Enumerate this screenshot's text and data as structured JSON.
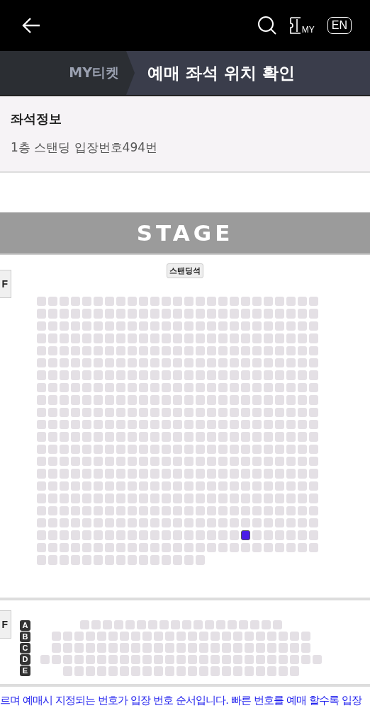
{
  "top_bar": {
    "language": "EN",
    "my_label": "MY"
  },
  "breadcrumb": {
    "parent": "MY티켓",
    "current": "예매 좌석 위치 확인"
  },
  "seat_info": {
    "title": "좌석정보",
    "value": "1층 스탠딩 입장번호494번"
  },
  "seat_map": {
    "stage": "STAGE",
    "floor_tabs": [
      "F",
      "F"
    ],
    "standing": {
      "label": "스탠딩석",
      "rows": [
        [
          false,
          false,
          false,
          false,
          false,
          false,
          false,
          false,
          false,
          false,
          false,
          false,
          false,
          false,
          false,
          false,
          false,
          false,
          false,
          false,
          false,
          false,
          false,
          false,
          false
        ],
        [
          false,
          false,
          false,
          false,
          false,
          false,
          false,
          false,
          false,
          false,
          false,
          false,
          false,
          false,
          false,
          false,
          false,
          false,
          false,
          false,
          false,
          false,
          false,
          false,
          false
        ],
        [
          false,
          false,
          false,
          false,
          false,
          false,
          false,
          false,
          false,
          false,
          false,
          false,
          false,
          false,
          false,
          false,
          false,
          false,
          false,
          false,
          false,
          false,
          false,
          false,
          false
        ],
        [
          false,
          false,
          false,
          false,
          false,
          false,
          false,
          false,
          false,
          false,
          false,
          false,
          false,
          false,
          false,
          false,
          false,
          false,
          false,
          false,
          false,
          false,
          false,
          false,
          false
        ],
        [
          false,
          false,
          false,
          false,
          false,
          false,
          false,
          false,
          false,
          false,
          false,
          false,
          false,
          false,
          false,
          false,
          false,
          false,
          false,
          false,
          false,
          false,
          false,
          false,
          false
        ],
        [
          false,
          false,
          false,
          false,
          false,
          false,
          false,
          false,
          false,
          false,
          false,
          false,
          false,
          false,
          false,
          false,
          false,
          false,
          false,
          false,
          false,
          false,
          false,
          false,
          false
        ],
        [
          false,
          false,
          false,
          false,
          false,
          false,
          false,
          false,
          false,
          false,
          false,
          false,
          false,
          false,
          false,
          false,
          false,
          false,
          false,
          false,
          false,
          false,
          false,
          false,
          false
        ],
        [
          false,
          false,
          false,
          false,
          false,
          false,
          false,
          false,
          false,
          false,
          false,
          false,
          false,
          false,
          false,
          false,
          false,
          false,
          false,
          false,
          false,
          false,
          false,
          false,
          false
        ],
        [
          false,
          false,
          false,
          false,
          false,
          false,
          false,
          false,
          false,
          false,
          false,
          false,
          false,
          false,
          false,
          false,
          false,
          false,
          false,
          false,
          false,
          false,
          false,
          false,
          false
        ],
        [
          false,
          false,
          false,
          false,
          false,
          false,
          false,
          false,
          false,
          false,
          false,
          false,
          false,
          false,
          false,
          false,
          false,
          false,
          false,
          false,
          false,
          false,
          false,
          false,
          false
        ],
        [
          false,
          false,
          false,
          false,
          false,
          false,
          false,
          false,
          false,
          false,
          false,
          false,
          false,
          false,
          false,
          false,
          false,
          false,
          false,
          false,
          false,
          false,
          false,
          false,
          false
        ],
        [
          false,
          false,
          false,
          false,
          false,
          false,
          false,
          false,
          false,
          false,
          false,
          false,
          false,
          false,
          false,
          false,
          false,
          false,
          false,
          false,
          false,
          false,
          false,
          false,
          false
        ],
        [
          false,
          false,
          false,
          false,
          false,
          false,
          false,
          false,
          false,
          false,
          false,
          false,
          false,
          false,
          false,
          false,
          false,
          false,
          false,
          false,
          false,
          false,
          false,
          false,
          false
        ],
        [
          false,
          false,
          false,
          false,
          false,
          false,
          false,
          false,
          false,
          false,
          false,
          false,
          false,
          false,
          false,
          false,
          false,
          false,
          false,
          false,
          false,
          false,
          false,
          false,
          false
        ],
        [
          false,
          false,
          false,
          false,
          false,
          false,
          false,
          false,
          false,
          false,
          false,
          false,
          false,
          false,
          false,
          false,
          false,
          false,
          false,
          false,
          false,
          false,
          false,
          false,
          false
        ],
        [
          false,
          false,
          false,
          false,
          false,
          false,
          false,
          false,
          false,
          false,
          false,
          false,
          false,
          false,
          false,
          false,
          false,
          false,
          false,
          false,
          false,
          false,
          false,
          false,
          false
        ],
        [
          false,
          false,
          false,
          false,
          false,
          false,
          false,
          false,
          false,
          false,
          false,
          false,
          false,
          false,
          false,
          false,
          false,
          false,
          false,
          false,
          false,
          false,
          false,
          false,
          false
        ],
        [
          false,
          false,
          false,
          false,
          false,
          false,
          false,
          false,
          false,
          false,
          false,
          false,
          false,
          false,
          false,
          false,
          false,
          false,
          false,
          false,
          false,
          false,
          false,
          false,
          false
        ],
        [
          false,
          false,
          false,
          false,
          false,
          false,
          false,
          false,
          false,
          false,
          false,
          false,
          false,
          false,
          false,
          false,
          false,
          false,
          false,
          false,
          false,
          false,
          false,
          false,
          false
        ],
        [
          false,
          false,
          false,
          false,
          false,
          false,
          false,
          false,
          false,
          false,
          false,
          false,
          false,
          false,
          false,
          false,
          false,
          false,
          true,
          false,
          false,
          false,
          false,
          false,
          false
        ],
        [
          false,
          false,
          false,
          false,
          false,
          false,
          false,
          false,
          false,
          false,
          false,
          false,
          false,
          false,
          false,
          false,
          false,
          false,
          false,
          false,
          false,
          false,
          false,
          false,
          false
        ],
        [
          false,
          false,
          false,
          false,
          false,
          false,
          false,
          false,
          false,
          false,
          false,
          false,
          false,
          false,
          false
        ]
      ]
    },
    "balcony": {
      "rows": [
        {
          "label": "A",
          "seats": [
            false,
            false,
            false,
            false,
            false,
            false,
            false,
            false,
            false,
            false,
            false,
            false,
            false,
            false,
            false,
            false,
            false,
            false
          ]
        },
        {
          "label": "B",
          "seats": [
            false,
            false,
            false,
            false,
            false,
            false,
            false,
            false,
            false,
            false,
            false,
            false,
            false,
            false,
            false,
            false,
            false,
            false,
            false,
            false,
            false,
            false,
            false
          ]
        },
        {
          "label": "C",
          "seats": [
            false,
            false,
            false,
            false,
            false,
            false,
            false,
            false,
            false,
            false,
            false,
            false,
            false,
            false,
            false,
            false,
            false,
            false,
            false,
            false,
            false,
            false,
            false
          ]
        },
        {
          "label": "D",
          "seats": [
            false,
            false,
            false,
            false,
            false,
            false,
            false,
            false,
            false,
            false,
            false,
            false,
            false,
            false,
            false,
            false,
            false,
            false,
            false,
            false,
            false,
            false,
            false,
            false,
            false
          ]
        },
        {
          "label": "E",
          "seats": [
            false,
            false,
            false,
            false,
            false,
            false,
            false,
            false,
            false,
            false,
            false,
            false,
            false,
            false,
            false,
            false,
            false,
            false,
            false,
            false,
            false
          ]
        }
      ]
    }
  },
  "notice": "르며 예매시 지정되는 번호가 입장 번호 순서입니다. 빠른 번호를 예매 할수록 입장"
}
